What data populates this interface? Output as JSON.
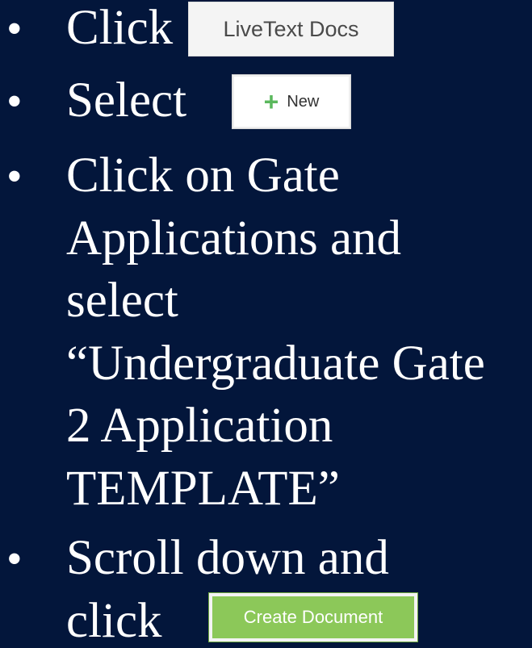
{
  "steps": [
    {
      "bullet": "•",
      "lines": [
        "Click"
      ]
    },
    {
      "bullet": "•",
      "lines": [
        "Select"
      ]
    },
    {
      "bullet": "•",
      "lines": [
        "Click on Gate",
        "Applications and",
        "select",
        "“Undergraduate Gate",
        "2 Application",
        "TEMPLATE”"
      ]
    },
    {
      "bullet": "•",
      "lines": [
        "Scroll down and",
        "click"
      ]
    }
  ],
  "buttons": {
    "livetext_docs": "LiveText Docs",
    "new": "New",
    "create_document": "Create Document"
  },
  "icons": {
    "plus": "+"
  },
  "colors": {
    "background": "#03163b",
    "text": "#ffffff",
    "create_button": "#8cc859",
    "plus_icon": "#5bb85d"
  }
}
